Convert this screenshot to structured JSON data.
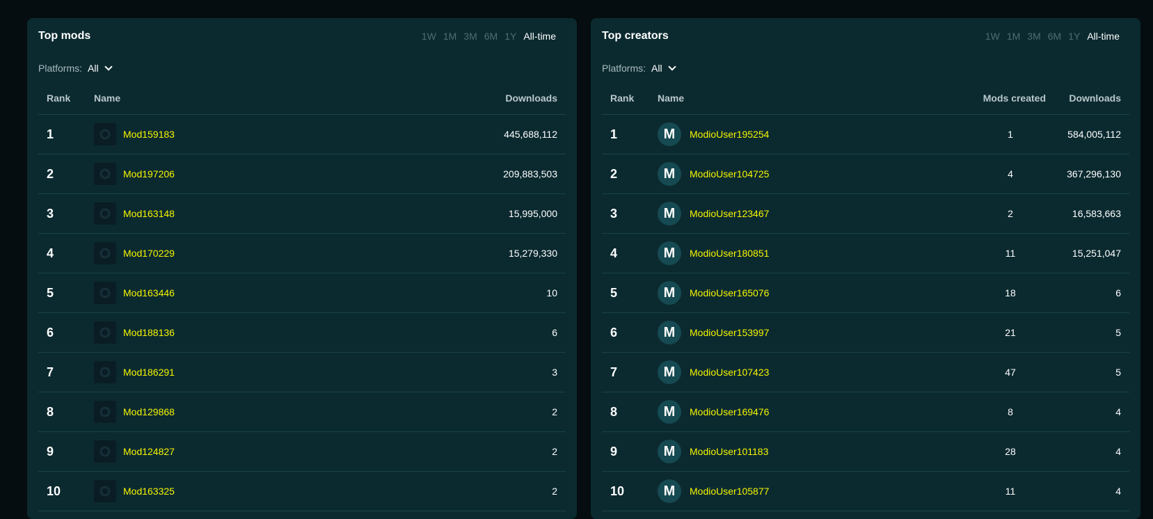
{
  "ranges": [
    "1W",
    "1M",
    "3M",
    "6M",
    "1Y",
    "All-time"
  ],
  "active_range": "All-time",
  "mods": {
    "title": "Top mods",
    "platforms_label": "Platforms:",
    "platforms_value": "All",
    "headers": {
      "rank": "Rank",
      "name": "Name",
      "downloads": "Downloads"
    },
    "rows": [
      {
        "rank": "1",
        "name": "Mod159183",
        "downloads": "445,688,112"
      },
      {
        "rank": "2",
        "name": "Mod197206",
        "downloads": "209,883,503"
      },
      {
        "rank": "3",
        "name": "Mod163148",
        "downloads": "15,995,000"
      },
      {
        "rank": "4",
        "name": "Mod170229",
        "downloads": "15,279,330"
      },
      {
        "rank": "5",
        "name": "Mod163446",
        "downloads": "10"
      },
      {
        "rank": "6",
        "name": "Mod188136",
        "downloads": "6"
      },
      {
        "rank": "7",
        "name": "Mod186291",
        "downloads": "3"
      },
      {
        "rank": "8",
        "name": "Mod129868",
        "downloads": "2"
      },
      {
        "rank": "9",
        "name": "Mod124827",
        "downloads": "2"
      },
      {
        "rank": "10",
        "name": "Mod163325",
        "downloads": "2"
      }
    ]
  },
  "creators": {
    "title": "Top creators",
    "platforms_label": "Platforms:",
    "platforms_value": "All",
    "headers": {
      "rank": "Rank",
      "name": "Name",
      "mods_created": "Mods created",
      "downloads": "Downloads"
    },
    "avatar_letter": "M",
    "rows": [
      {
        "rank": "1",
        "name": "ModioUser195254",
        "mods_created": "1",
        "downloads": "584,005,112"
      },
      {
        "rank": "2",
        "name": "ModioUser104725",
        "mods_created": "4",
        "downloads": "367,296,130"
      },
      {
        "rank": "3",
        "name": "ModioUser123467",
        "mods_created": "2",
        "downloads": "16,583,663"
      },
      {
        "rank": "4",
        "name": "ModioUser180851",
        "mods_created": "11",
        "downloads": "15,251,047"
      },
      {
        "rank": "5",
        "name": "ModioUser165076",
        "mods_created": "18",
        "downloads": "6"
      },
      {
        "rank": "6",
        "name": "ModioUser153997",
        "mods_created": "21",
        "downloads": "5"
      },
      {
        "rank": "7",
        "name": "ModioUser107423",
        "mods_created": "47",
        "downloads": "5"
      },
      {
        "rank": "8",
        "name": "ModioUser169476",
        "mods_created": "8",
        "downloads": "4"
      },
      {
        "rank": "9",
        "name": "ModioUser101183",
        "mods_created": "28",
        "downloads": "4"
      },
      {
        "rank": "10",
        "name": "ModioUser105877",
        "mods_created": "11",
        "downloads": "4"
      }
    ]
  }
}
